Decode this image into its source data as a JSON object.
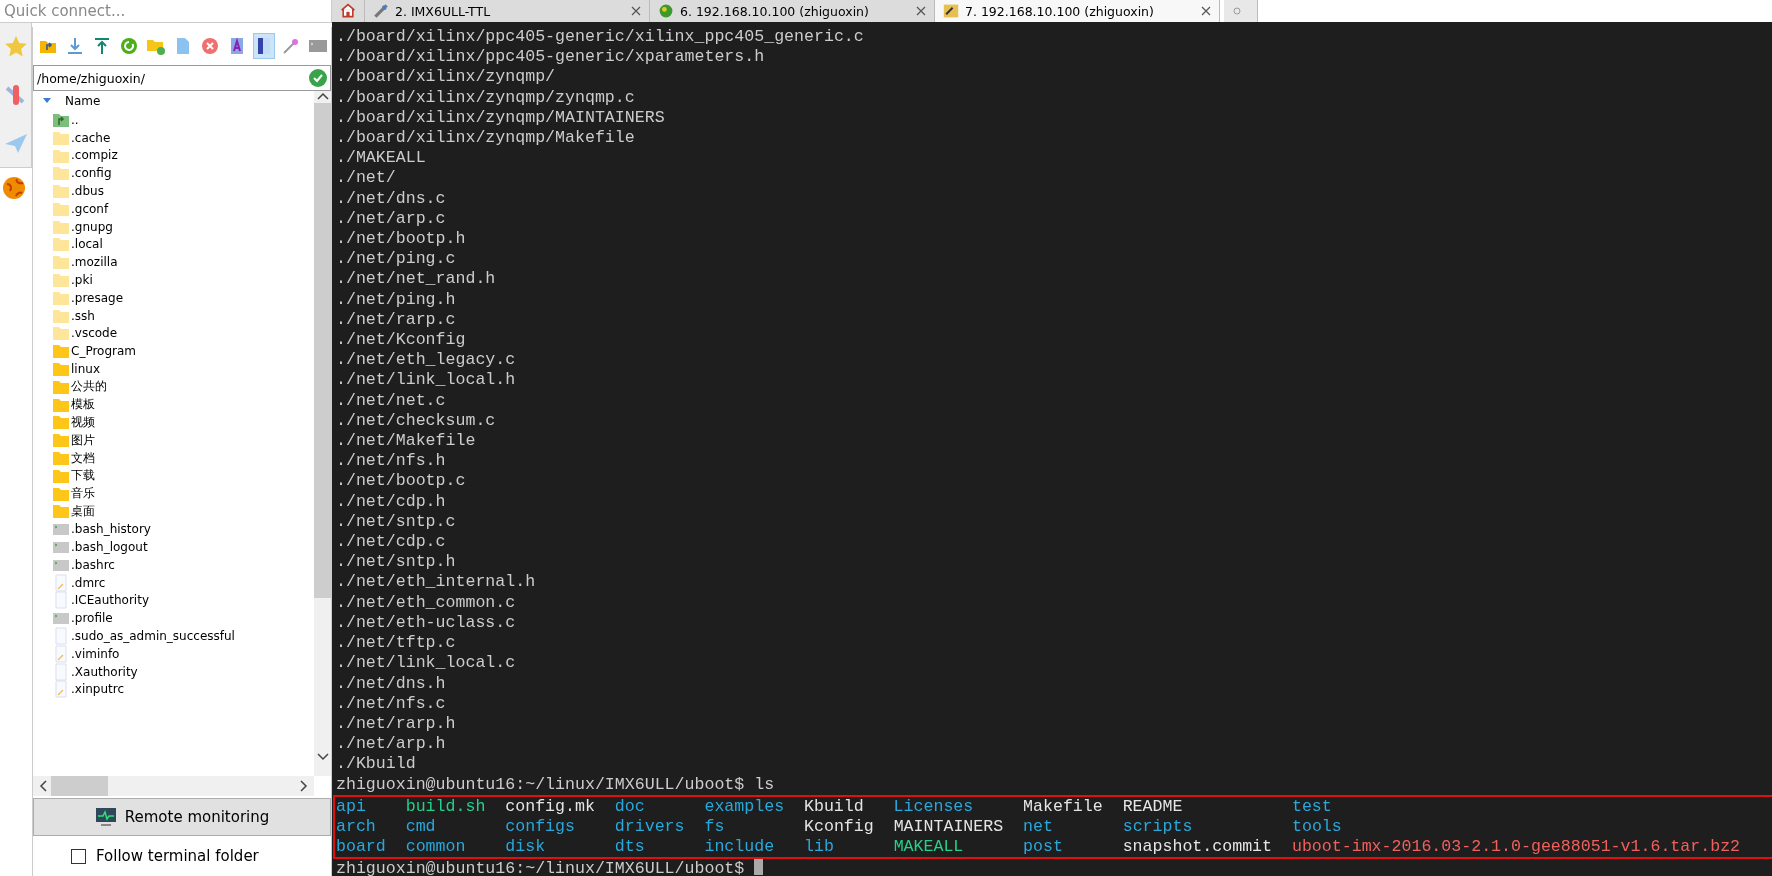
{
  "quick_connect": {
    "placeholder": "Quick connect..."
  },
  "tabs": [
    {
      "kind": "home",
      "selected": false
    },
    {
      "kind": "serial",
      "label": "2. IMX6ULL-TTL",
      "selected": false
    },
    {
      "kind": "ssh",
      "label": "6. 192.168.10.100 (zhiguoxin)",
      "selected": false
    },
    {
      "kind": "ssh-key",
      "label": "7. 192.168.10.100 (zhiguoxin)",
      "selected": true
    }
  ],
  "toolbar": [
    {
      "kind": "parent-folder",
      "selected": false
    },
    {
      "kind": "download",
      "selected": false
    },
    {
      "kind": "upload",
      "selected": false
    },
    {
      "kind": "refresh",
      "selected": false
    },
    {
      "kind": "new-folder",
      "selected": false
    },
    {
      "kind": "new-file",
      "selected": false
    },
    {
      "kind": "delete",
      "selected": false
    },
    {
      "kind": "rename",
      "selected": false
    },
    {
      "kind": "split",
      "selected": true
    },
    {
      "kind": "wand",
      "selected": false
    },
    {
      "kind": "terminal",
      "selected": false
    }
  ],
  "path": {
    "value": "/home/zhiguoxin/"
  },
  "file_list": {
    "column": "Name",
    "items": [
      {
        "kind": "parent",
        "name": ".."
      },
      {
        "kind": "hidden-folder",
        "name": ".cache"
      },
      {
        "kind": "hidden-folder",
        "name": ".compiz"
      },
      {
        "kind": "hidden-folder",
        "name": ".config"
      },
      {
        "kind": "hidden-folder",
        "name": ".dbus"
      },
      {
        "kind": "hidden-folder",
        "name": ".gconf"
      },
      {
        "kind": "hidden-folder",
        "name": ".gnupg"
      },
      {
        "kind": "hidden-folder",
        "name": ".local"
      },
      {
        "kind": "hidden-folder",
        "name": ".mozilla"
      },
      {
        "kind": "hidden-folder",
        "name": ".pki"
      },
      {
        "kind": "hidden-folder",
        "name": ".presage"
      },
      {
        "kind": "hidden-folder",
        "name": ".ssh"
      },
      {
        "kind": "hidden-folder",
        "name": ".vscode"
      },
      {
        "kind": "folder",
        "name": "C_Program"
      },
      {
        "kind": "folder",
        "name": "linux"
      },
      {
        "kind": "folder",
        "name": "公共的"
      },
      {
        "kind": "folder",
        "name": "模板"
      },
      {
        "kind": "folder",
        "name": "视频"
      },
      {
        "kind": "folder",
        "name": "图片"
      },
      {
        "kind": "folder",
        "name": "文档"
      },
      {
        "kind": "folder",
        "name": "下载"
      },
      {
        "kind": "folder",
        "name": "音乐"
      },
      {
        "kind": "folder",
        "name": "桌面"
      },
      {
        "kind": "script",
        "name": ".bash_history"
      },
      {
        "kind": "script",
        "name": ".bash_logout"
      },
      {
        "kind": "script",
        "name": ".bashrc"
      },
      {
        "kind": "text-file",
        "name": ".dmrc"
      },
      {
        "kind": "file",
        "name": ".ICEauthority"
      },
      {
        "kind": "script",
        "name": ".profile"
      },
      {
        "kind": "file",
        "name": ".sudo_as_admin_successful"
      },
      {
        "kind": "text-file",
        "name": ".viminfo"
      },
      {
        "kind": "file",
        "name": ".Xauthority"
      },
      {
        "kind": "text-file",
        "name": ".xinputrc"
      }
    ]
  },
  "remote_monitoring": {
    "label": "Remote monitoring"
  },
  "follow_terminal": {
    "label": "Follow terminal folder",
    "checked": false
  },
  "terminal": {
    "output": [
      "./board/xilinx/ppc405-generic/xilinx_ppc405_generic.c",
      "./board/xilinx/ppc405-generic/xparameters.h",
      "./board/xilinx/zynqmp/",
      "./board/xilinx/zynqmp/zynqmp.c",
      "./board/xilinx/zynqmp/MAINTAINERS",
      "./board/xilinx/zynqmp/Makefile",
      "./MAKEALL",
      "./net/",
      "./net/dns.c",
      "./net/arp.c",
      "./net/bootp.h",
      "./net/ping.c",
      "./net/net_rand.h",
      "./net/ping.h",
      "./net/rarp.c",
      "./net/Kconfig",
      "./net/eth_legacy.c",
      "./net/link_local.h",
      "./net/net.c",
      "./net/checksum.c",
      "./net/Makefile",
      "./net/nfs.h",
      "./net/bootp.c",
      "./net/cdp.h",
      "./net/sntp.c",
      "./net/cdp.c",
      "./net/sntp.h",
      "./net/eth_internal.h",
      "./net/eth_common.c",
      "./net/eth-uclass.c",
      "./net/tftp.c",
      "./net/link_local.c",
      "./net/dns.h",
      "./net/nfs.c",
      "./net/rarp.h",
      "./net/arp.h",
      "./Kbuild",
      "zhiguoxin@ubuntu16:~/linux/IMX6ULL/uboot$ ls"
    ],
    "listing": [
      [
        {
          "text": "api",
          "color": "#29a8dc"
        },
        {
          "text": "build.sh",
          "color": "#23d18b"
        },
        {
          "text": "config.mk",
          "color": "#e5e5e5"
        },
        {
          "text": "doc",
          "color": "#29a8dc"
        },
        {
          "text": "examples",
          "color": "#29a8dc"
        },
        {
          "text": "Kbuild",
          "color": "#e5e5e5"
        },
        {
          "text": "Licenses",
          "color": "#29a8dc"
        },
        {
          "text": "Makefile",
          "color": "#e5e5e5"
        },
        {
          "text": "README",
          "color": "#e5e5e5"
        },
        {
          "text": "test",
          "color": "#29a8dc"
        }
      ],
      [
        {
          "text": "arch",
          "color": "#29a8dc"
        },
        {
          "text": "cmd",
          "color": "#29a8dc"
        },
        {
          "text": "configs",
          "color": "#29a8dc"
        },
        {
          "text": "drivers",
          "color": "#29a8dc"
        },
        {
          "text": "fs",
          "color": "#29a8dc"
        },
        {
          "text": "Kconfig",
          "color": "#e5e5e5"
        },
        {
          "text": "MAINTAINERS",
          "color": "#e5e5e5"
        },
        {
          "text": "net",
          "color": "#29a8dc"
        },
        {
          "text": "scripts",
          "color": "#29a8dc"
        },
        {
          "text": "tools",
          "color": "#29a8dc"
        }
      ],
      [
        {
          "text": "board",
          "color": "#29a8dc"
        },
        {
          "text": "common",
          "color": "#29a8dc"
        },
        {
          "text": "disk",
          "color": "#29a8dc"
        },
        {
          "text": "dts",
          "color": "#29a8dc"
        },
        {
          "text": "include",
          "color": "#29a8dc"
        },
        {
          "text": "lib",
          "color": "#29a8dc"
        },
        {
          "text": "MAKEALL",
          "color": "#23d18b"
        },
        {
          "text": "post",
          "color": "#29a8dc"
        },
        {
          "text": "snapshot.commit",
          "color": "#e5e5e5"
        },
        {
          "text": "uboot-imx-2016.03-2.1.0-gee88051-v1.6.tar.bz2",
          "color": "#f0605c"
        }
      ]
    ],
    "prompt": "zhiguoxin@ubuntu16:~/linux/IMX6ULL/uboot$"
  }
}
